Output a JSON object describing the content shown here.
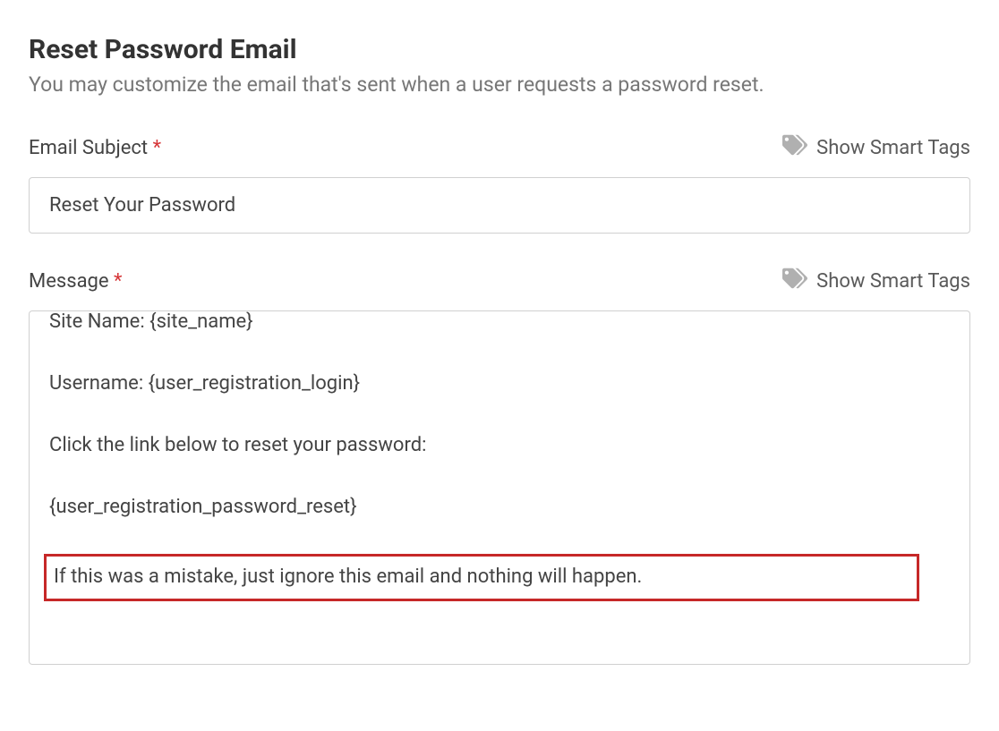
{
  "header": {
    "title": "Reset Password Email",
    "subtitle": "You may customize the email that's sent when a user requests a password reset."
  },
  "fields": {
    "subject": {
      "label": "Email Subject",
      "required_marker": "*",
      "smart_tags_label": "Show Smart Tags",
      "value": "Reset Your Password"
    },
    "message": {
      "label": "Message",
      "required_marker": "*",
      "smart_tags_label": "Show Smart Tags",
      "lines": {
        "l1": "Site Name: {site_name}",
        "l2": "Username: {user_registration_login}",
        "l3": "Click the link below to reset your password:",
        "l4": "{user_registration_password_reset}",
        "l5": "If this was a mistake, just ignore this email and nothing will happen."
      }
    }
  }
}
